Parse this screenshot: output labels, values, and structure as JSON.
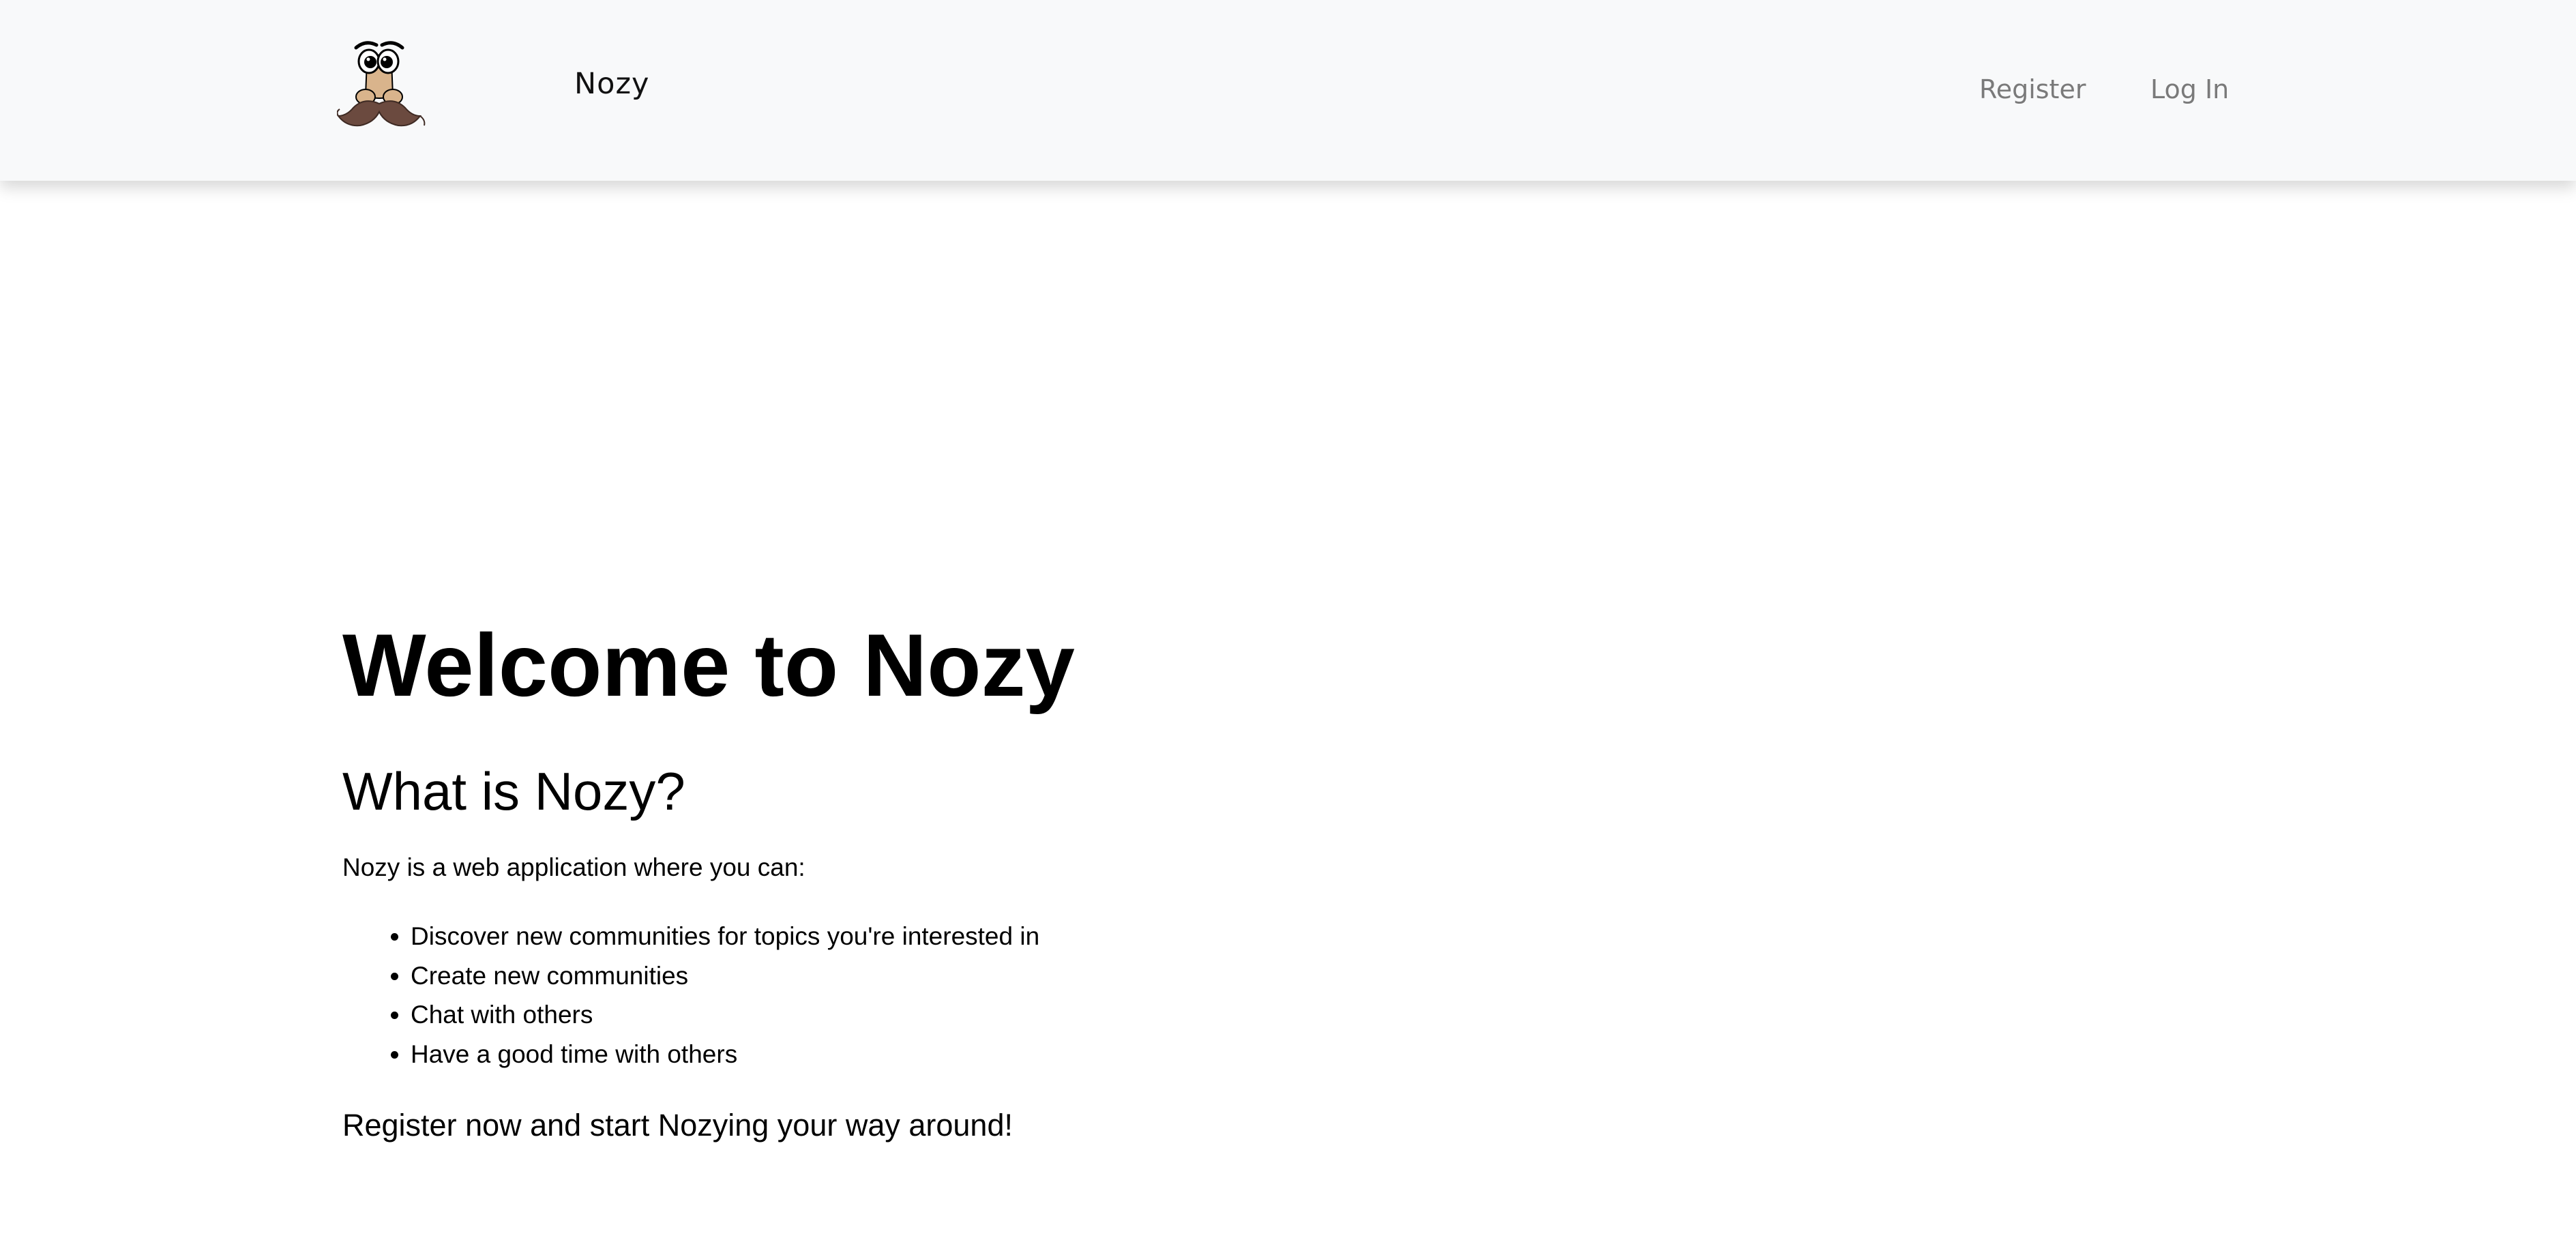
{
  "navbar": {
    "brand_name": "Nozy",
    "logo_icon": "mustache-face-logo-icon",
    "links": {
      "register": "Register",
      "login": "Log In"
    }
  },
  "main": {
    "hero_title": "Welcome to Nozy",
    "section_title": "What is Nozy?",
    "intro": "Nozy is a web application where you can:",
    "features": [
      "Discover new communities for topics you're interested in",
      "Create new communities",
      "Chat with others",
      "Have a good time with others"
    ],
    "cta": "Register now and start Nozying your way around!"
  },
  "colors": {
    "navbar_bg": "#f8f9fa",
    "nav_link": "#7a7a7a",
    "mustache": "#6b4a3f",
    "nose": "#d9b48c"
  }
}
